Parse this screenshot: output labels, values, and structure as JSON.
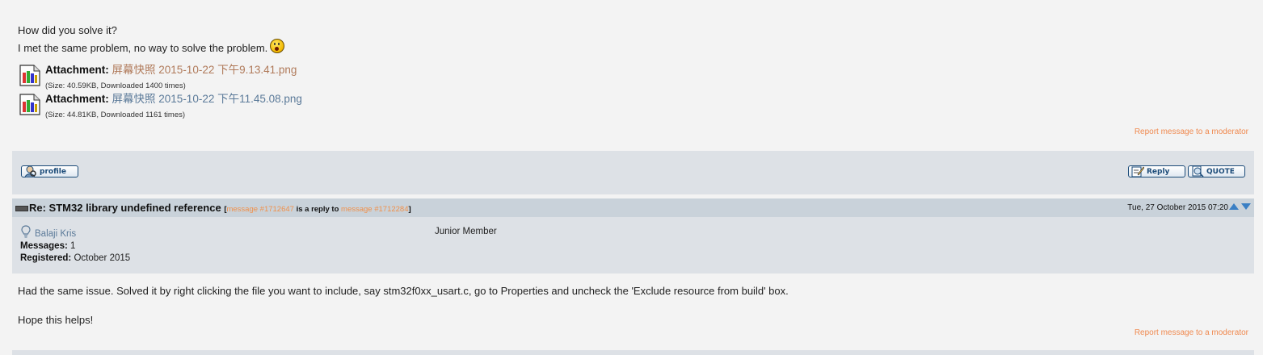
{
  "post1": {
    "lines": [
      "How did you solve it?",
      "I met the same problem, no way to solve the problem."
    ],
    "emoji": "surprised-face",
    "attachments": [
      {
        "label": "Attachment:",
        "filename": "屏幕快照 2015-10-22 下午9.13.41.png",
        "size_info": "(Size: 40.59KB, Downloaded 1400 times)"
      },
      {
        "label": "Attachment:",
        "filename": "屏幕快照 2015-10-22 下午11.45.08.png",
        "size_info": "(Size: 44.81KB, Downloaded 1161 times)"
      }
    ],
    "report_link": "Report message to a moderator"
  },
  "toolbar": {
    "profile_label": "profile",
    "reply_label": "Reply",
    "quote_label": "QUOTE"
  },
  "post2": {
    "subject": "Re: STM32 library undefined reference",
    "meta_open": "[",
    "message_link": "message #1712647",
    "reply_text": " is a reply to ",
    "reply_link": "message #1712284",
    "meta_close": "]",
    "date": "Tue, 27 October 2015 07:20",
    "user": {
      "name": "Balaji Kris",
      "rank": "Junior Member",
      "messages_label": "Messages:",
      "messages_value": " 1",
      "registered_label": "Registered:",
      "registered_value": " October 2015"
    },
    "body": [
      "Had the same issue. Solved it by right clicking the file you want to include, say stm32f0xx_usart.c, go to Properties and uncheck the 'Exclude resource from build' box.",
      "Hope this helps!"
    ],
    "report_link": "Report message to a moderator"
  },
  "colors": {
    "toolbar_bg": "#dde1e6",
    "header_bg": "#c9d2da",
    "link_orange": "#f0904a",
    "link_blue": "#5b7a99"
  }
}
